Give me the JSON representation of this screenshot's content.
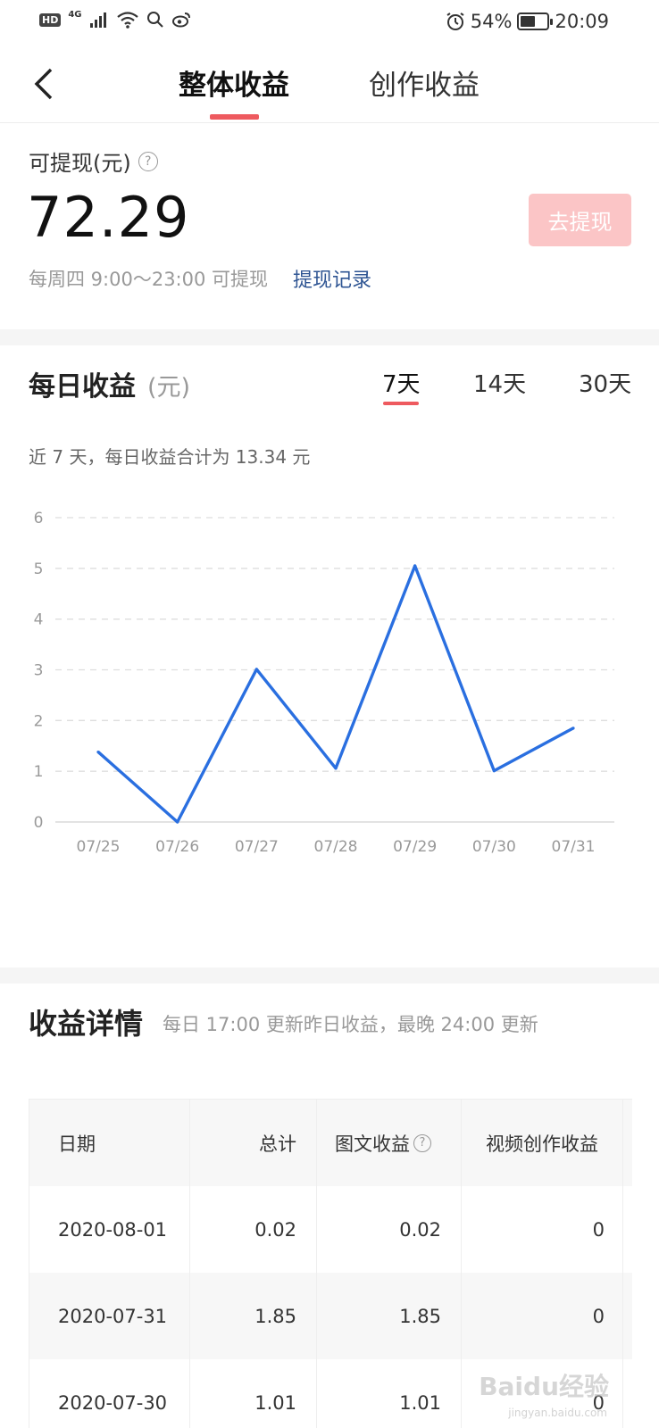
{
  "status_bar": {
    "hd": "HD",
    "network": "4G",
    "alarm_icon": "alarm-icon",
    "battery_percent": "54%",
    "battery_level": 0.54,
    "time": "20:09"
  },
  "nav": {
    "tabs": [
      {
        "label": "整体收益",
        "active": true
      },
      {
        "label": "创作收益",
        "active": false
      }
    ],
    "back_icon": "chevron-left-icon"
  },
  "balance": {
    "label": "可提现(元)",
    "amount": "72.29",
    "withdraw_label": "去提现",
    "note": "每周四 9:00～23:00 可提现",
    "record_link": "提现记录"
  },
  "daily": {
    "title": "每日收益",
    "unit": "(元)",
    "ranges": [
      "7天",
      "14天",
      "30天"
    ],
    "summary": "近 7 天，每日收益合计为 13.34 元"
  },
  "chart_data": {
    "type": "line",
    "x": [
      "07/25",
      "07/26",
      "07/27",
      "07/28",
      "07/29",
      "07/30",
      "07/31"
    ],
    "y_ticks": [
      "0",
      "1",
      "2",
      "3",
      "4",
      "5",
      "6"
    ],
    "values": [
      1.38,
      0,
      3.01,
      1.06,
      5.05,
      1.01,
      1.85
    ],
    "ylim": [
      0,
      6
    ],
    "grid": true,
    "line_color": "#2a6fe0"
  },
  "details": {
    "title": "收益详情",
    "note": "每日 17:00 更新昨日收益，最晚 24:00 更新",
    "columns": [
      "日期",
      "总计",
      "图文收益",
      "视频创作收益"
    ],
    "rows": [
      [
        "2020-08-01",
        "0.02",
        "0.02",
        "0"
      ],
      [
        "2020-07-31",
        "1.85",
        "1.85",
        "0"
      ],
      [
        "2020-07-30",
        "1.01",
        "1.01",
        "0"
      ]
    ]
  },
  "watermark": {
    "text": "Baidu经验",
    "sub": "jingyan.baidu.com"
  }
}
